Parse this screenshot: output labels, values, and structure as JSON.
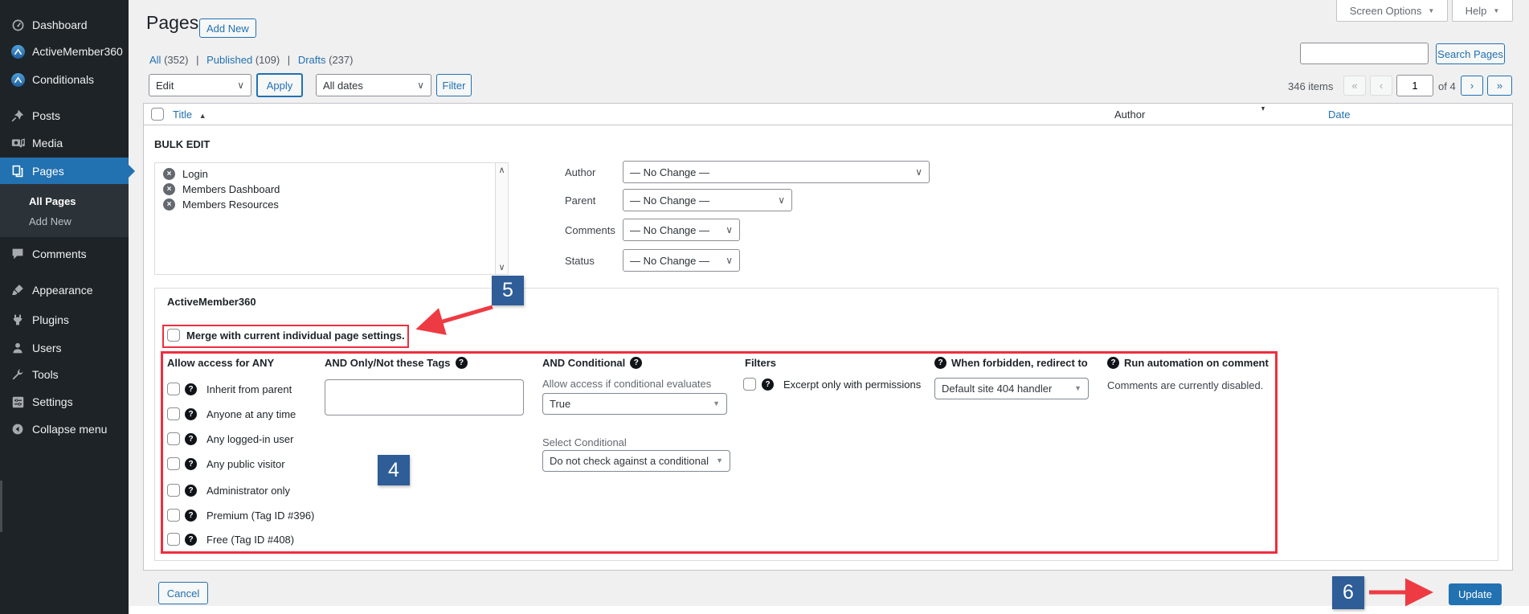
{
  "toolbar": {
    "screen_options_label": "Screen Options",
    "help_label": "Help"
  },
  "sidebar": {
    "items": [
      {
        "label": "Dashboard"
      },
      {
        "label": "ActiveMember360"
      },
      {
        "label": "Conditionals"
      },
      {
        "label": "Posts"
      },
      {
        "label": "Media"
      },
      {
        "label": "Pages"
      },
      {
        "label": "Comments"
      },
      {
        "label": "Appearance"
      },
      {
        "label": "Plugins"
      },
      {
        "label": "Users"
      },
      {
        "label": "Tools"
      },
      {
        "label": "Settings"
      },
      {
        "label": "Collapse menu"
      }
    ],
    "submenu": [
      {
        "label": "All Pages"
      },
      {
        "label": "Add New"
      }
    ]
  },
  "header": {
    "title": "Pages",
    "add_new_label": "Add New"
  },
  "views": [
    {
      "label": "All",
      "count": "(352)"
    },
    {
      "label": "Published",
      "count": "(109)"
    },
    {
      "label": "Drafts",
      "count": "(237)"
    }
  ],
  "view_separator": "|",
  "filters": {
    "bulk_action_value": "Edit",
    "apply_label": "Apply",
    "date_filter_value": "All dates",
    "filter_label": "Filter"
  },
  "search": {
    "button_label": "Search Pages",
    "input_value": ""
  },
  "pagination": {
    "items_count": "346 items",
    "first": "«",
    "prev": "‹",
    "current_page": "1",
    "of_label": "of 4",
    "next": "›",
    "last": "»"
  },
  "table": {
    "col_title": "Title",
    "col_author": "Author",
    "col_date": "Date"
  },
  "bulk_edit": {
    "legend": "BULK EDIT",
    "selected_pages": [
      "Login",
      "Members Dashboard",
      "Members Resources"
    ],
    "fields": [
      {
        "label": "Author",
        "value": "— No Change —"
      },
      {
        "label": "Parent",
        "value": "— No Change —"
      },
      {
        "label": "Comments",
        "value": "— No Change —"
      },
      {
        "label": "Status",
        "value": "— No Change —"
      }
    ]
  },
  "am360": {
    "title": "ActiveMember360",
    "merge_label": "Merge with current individual page settings.",
    "access": {
      "header": "Allow access for ANY",
      "options": [
        "Inherit from parent",
        "Anyone at any time",
        "Any logged-in user",
        "Any public visitor",
        "Administrator only",
        "Premium (Tag ID #396)",
        "Free (Tag ID #408)"
      ]
    },
    "tags": {
      "header": "AND Only/Not these Tags",
      "value": ""
    },
    "conditional": {
      "header": "AND Conditional",
      "evaluates_label": "Allow access if conditional evaluates",
      "evaluates_value": "True",
      "select_label": "Select Conditional",
      "select_value": "Do not check against a conditional"
    },
    "filters_col": {
      "header": "Filters",
      "excerpt_label": "Excerpt only with permissions"
    },
    "redirect": {
      "header": "When forbidden, redirect to",
      "value": "Default site 404 handler"
    },
    "automation": {
      "header": "Run automation on comment",
      "note": "Comments are currently disabled."
    }
  },
  "actions": {
    "cancel_label": "Cancel",
    "update_label": "Update"
  },
  "annotations": {
    "badge4": "4",
    "badge5": "5",
    "badge6": "6"
  },
  "icons": {
    "dropdown_caret": "▼",
    "select_chevron": "∨",
    "scroll_up": "∧",
    "scroll_down": "∨",
    "sort_asc": "▲",
    "help": "?",
    "remove": "×",
    "triangle_down": "▼"
  },
  "colors": {
    "accent": "#2271b1",
    "annotation_red": "#ee2e3e",
    "badge_blue": "#2e5d97"
  }
}
